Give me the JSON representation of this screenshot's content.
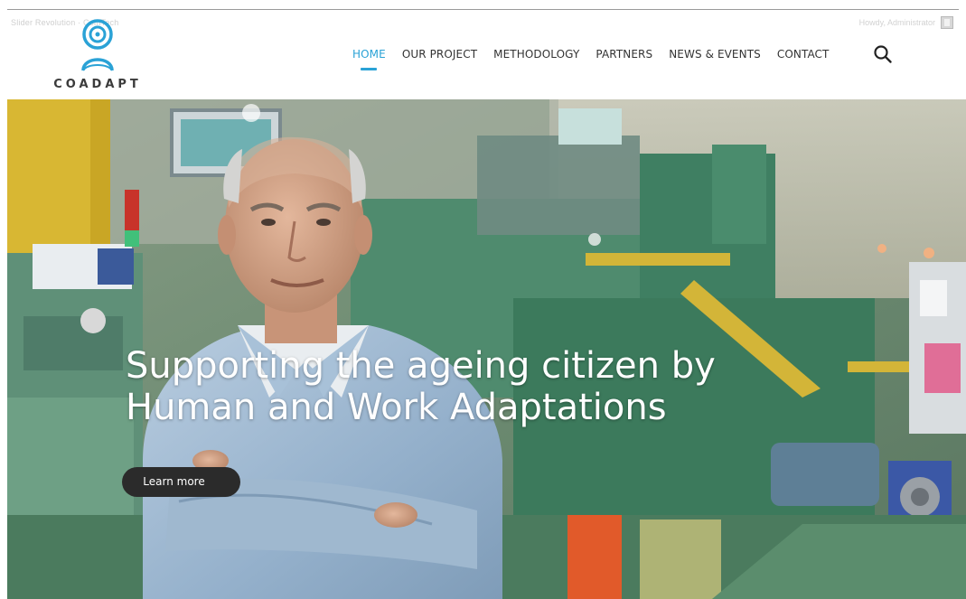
{
  "utility": {
    "left_text": "Slider Revolution · ComTech",
    "welcome_text": "Howdy, Administrator"
  },
  "brand": {
    "name": "COADAPT",
    "accent_color": "#2aa2d6"
  },
  "nav": {
    "items": [
      {
        "label": "HOME",
        "active": true
      },
      {
        "label": "OUR PROJECT",
        "active": false
      },
      {
        "label": "METHODOLOGY",
        "active": false
      },
      {
        "label": "PARTNERS",
        "active": false
      },
      {
        "label": "NEWS & EVENTS",
        "active": false
      },
      {
        "label": "CONTACT",
        "active": false
      }
    ],
    "search_icon": "search-icon"
  },
  "hero": {
    "title_line1": "Supporting the ageing citizen by",
    "title_line2": "Human and Work Adaptations",
    "cta_label": "Learn more"
  }
}
